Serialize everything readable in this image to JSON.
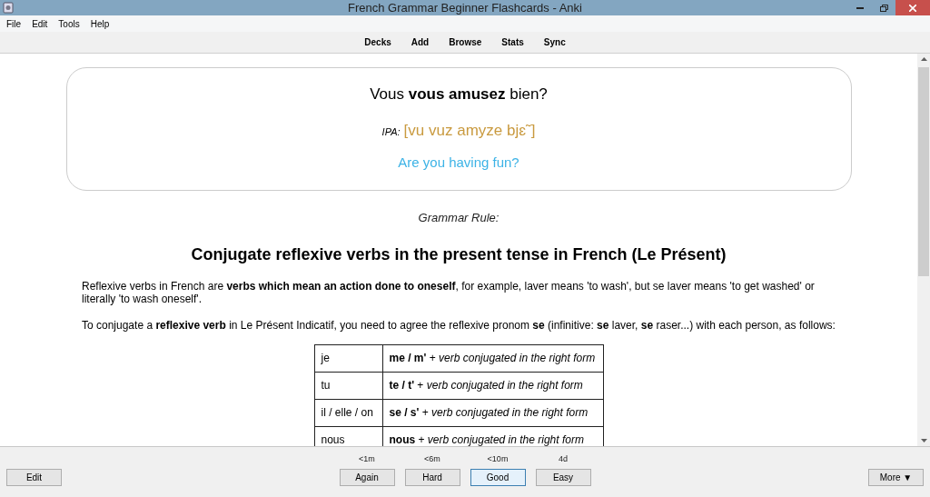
{
  "window": {
    "title": "French Grammar Beginner Flashcards - Anki"
  },
  "menu": [
    "File",
    "Edit",
    "Tools",
    "Help"
  ],
  "toolbar": [
    "Decks",
    "Add",
    "Browse",
    "Stats",
    "Sync"
  ],
  "card": {
    "front": "Vous **vous amusez** bien?",
    "ipa_label": "IPA:",
    "ipa": "[vu vuz amyze bjɛ˜]",
    "translation": "Are you having fun?"
  },
  "rule_label": "Grammar Rule:",
  "heading": "Conjugate reflexive verbs in the present tense in French (Le Présent)",
  "paragraphs": [
    "Reflexive verbs in French are **verbs which mean an action done to oneself**, for example, laver means 'to wash', but se laver means 'to get washed' or literally 'to wash oneself'.",
    "To conjugate a **reflexive verb** in Le Présent Indicatif, you need to agree the reflexive pronom **se** (infinitive: **se** laver, **se** raser...) with each person, as follows:"
  ],
  "table": {
    "rows": [
      {
        "person": "je",
        "form": "**me / m'** + *verb conjugated in the right form*"
      },
      {
        "person": "tu",
        "form": "**te / t'** + *verb conjugated in the right form*"
      },
      {
        "person": "il / elle / on",
        "form": "**se / s'** + *verb conjugated in the right form*"
      },
      {
        "person": "nous",
        "form": "**nous** + *verb conjugated in the right form*"
      }
    ]
  },
  "bottom": {
    "edit": "Edit",
    "more": "More ▼",
    "answers": [
      {
        "interval": "<1m",
        "label": "Again",
        "selected": false
      },
      {
        "interval": "<6m",
        "label": "Hard",
        "selected": false
      },
      {
        "interval": "<10m",
        "label": "Good",
        "selected": true
      },
      {
        "interval": "4d",
        "label": "Easy",
        "selected": false
      }
    ]
  }
}
